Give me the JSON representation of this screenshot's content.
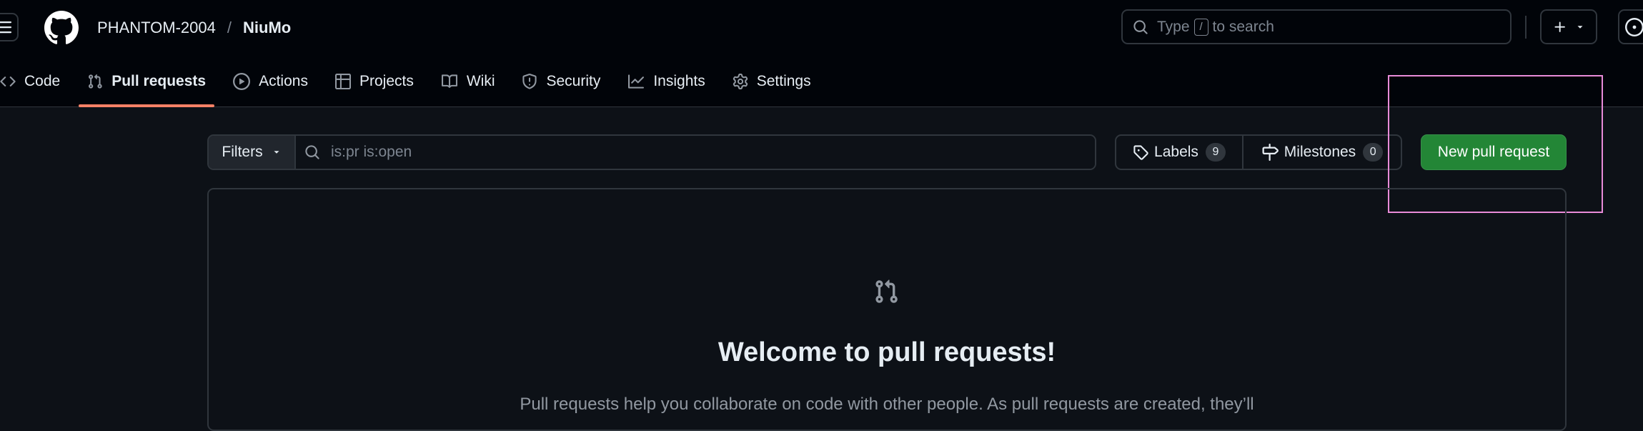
{
  "header": {
    "owner": "PHANTOM-2004",
    "separator": "/",
    "repo": "NiuMo",
    "search": {
      "prefix": "Type",
      "key": "/",
      "suffix": "to search"
    }
  },
  "tabs": [
    {
      "label": "Code",
      "icon": "code-icon"
    },
    {
      "label": "Pull requests",
      "icon": "git-pull-request-icon",
      "active": true
    },
    {
      "label": "Actions",
      "icon": "play-icon"
    },
    {
      "label": "Projects",
      "icon": "table-icon"
    },
    {
      "label": "Wiki",
      "icon": "book-icon"
    },
    {
      "label": "Security",
      "icon": "shield-icon"
    },
    {
      "label": "Insights",
      "icon": "graph-icon"
    },
    {
      "label": "Settings",
      "icon": "gear-icon"
    }
  ],
  "toolbar": {
    "filters_label": "Filters",
    "filter_value": "is:pr is:open",
    "labels_label": "Labels",
    "labels_count": "9",
    "milestones_label": "Milestones",
    "milestones_count": "0",
    "new_pr_label": "New pull request"
  },
  "blankslate": {
    "title": "Welcome to pull requests!",
    "description": "Pull requests help you collaborate on code with other people. As pull requests are created, they’ll"
  },
  "colors": {
    "header_bg": "#010409",
    "page_bg": "#0d1117",
    "border": "#30363d",
    "accent_underline": "#f78166",
    "primary_button": "#238636",
    "highlight_box": "#e88bd8"
  }
}
